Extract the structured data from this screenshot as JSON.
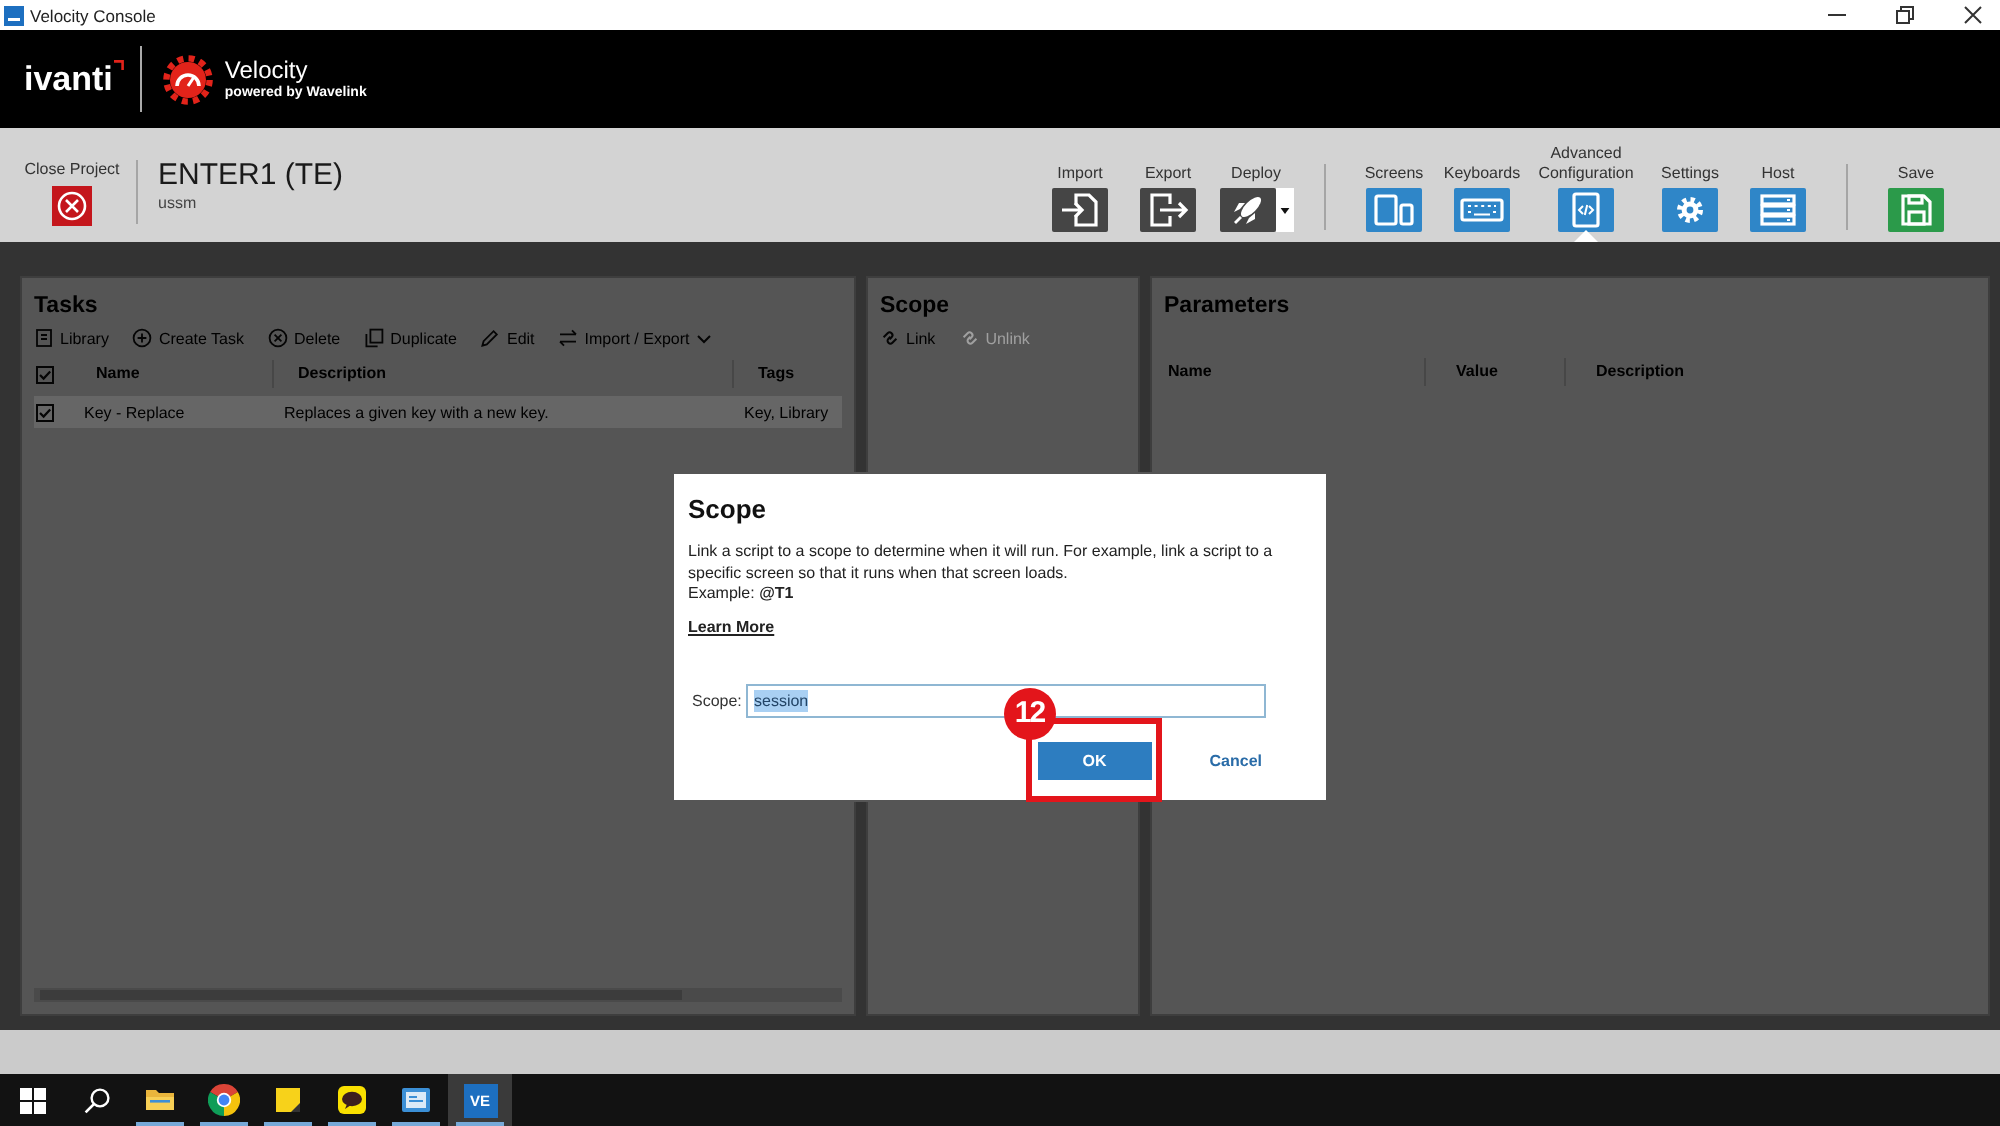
{
  "window": {
    "title": "Velocity Console"
  },
  "header": {
    "company": "ivanti",
    "product": "Velocity",
    "tagline": "powered by Wavelink"
  },
  "project": {
    "close_label": "Close Project",
    "name": "ENTER1 (TE)",
    "subtitle": "ussm"
  },
  "toolbar": [
    {
      "label": "Import",
      "kind": "action",
      "dropdown": false,
      "selected": false
    },
    {
      "label": "Export",
      "kind": "action",
      "dropdown": false,
      "selected": false
    },
    {
      "label": "Deploy",
      "kind": "action",
      "dropdown": true,
      "selected": false
    },
    {
      "label": "Screens",
      "kind": "config",
      "dropdown": false,
      "selected": false
    },
    {
      "label": "Keyboards",
      "kind": "config",
      "dropdown": false,
      "selected": false
    },
    {
      "label": "Advanced Configuration",
      "kind": "config",
      "dropdown": false,
      "selected": true
    },
    {
      "label": "Settings",
      "kind": "config",
      "dropdown": false,
      "selected": false
    },
    {
      "label": "Host",
      "kind": "config",
      "dropdown": false,
      "selected": false
    },
    {
      "label": "Save",
      "kind": "save",
      "dropdown": false,
      "selected": false
    }
  ],
  "tasks": {
    "title": "Tasks",
    "actions": [
      {
        "label": "Library",
        "dropdown": false
      },
      {
        "label": "Create Task",
        "dropdown": false
      },
      {
        "label": "Delete",
        "dropdown": false
      },
      {
        "label": "Duplicate",
        "dropdown": false
      },
      {
        "label": "Edit",
        "dropdown": false
      },
      {
        "label": "Import / Export",
        "dropdown": true
      }
    ],
    "columns": [
      "Name",
      "Description",
      "Tags"
    ],
    "all_checked": true,
    "rows": [
      {
        "checked": true,
        "selected": true,
        "name": "Key - Replace",
        "description": "Replaces a given key with a new key.",
        "tags": "Key, Library"
      }
    ]
  },
  "scope": {
    "title": "Scope",
    "actions": [
      {
        "label": "Link",
        "disabled": false
      },
      {
        "label": "Unlink",
        "disabled": true
      }
    ]
  },
  "parameters": {
    "title": "Parameters",
    "columns": [
      "Name",
      "Value",
      "Description"
    ]
  },
  "dialog": {
    "title": "Scope",
    "message": "Link a script to a scope to determine when it will run. For example, link a script to a specific screen so that it runs when that screen loads.",
    "example": "Example: **@T1**",
    "link": "Learn More",
    "field": {
      "label": "Scope:",
      "value": "session",
      "text_selected": true
    },
    "buttons": [
      {
        "label": "OK",
        "kind": "primary",
        "highlighted": true
      },
      {
        "label": "Cancel",
        "kind": "link",
        "highlighted": false
      }
    ]
  },
  "annotation": {
    "step": "12"
  },
  "taskbar": {
    "apps": [
      {
        "running": true,
        "selected": false
      },
      {
        "running": true,
        "selected": false
      },
      {
        "running": true,
        "selected": false
      },
      {
        "running": true,
        "selected": false
      },
      {
        "running": true,
        "selected": false
      },
      {
        "running": true,
        "selected": true,
        "label": "VE"
      }
    ]
  }
}
